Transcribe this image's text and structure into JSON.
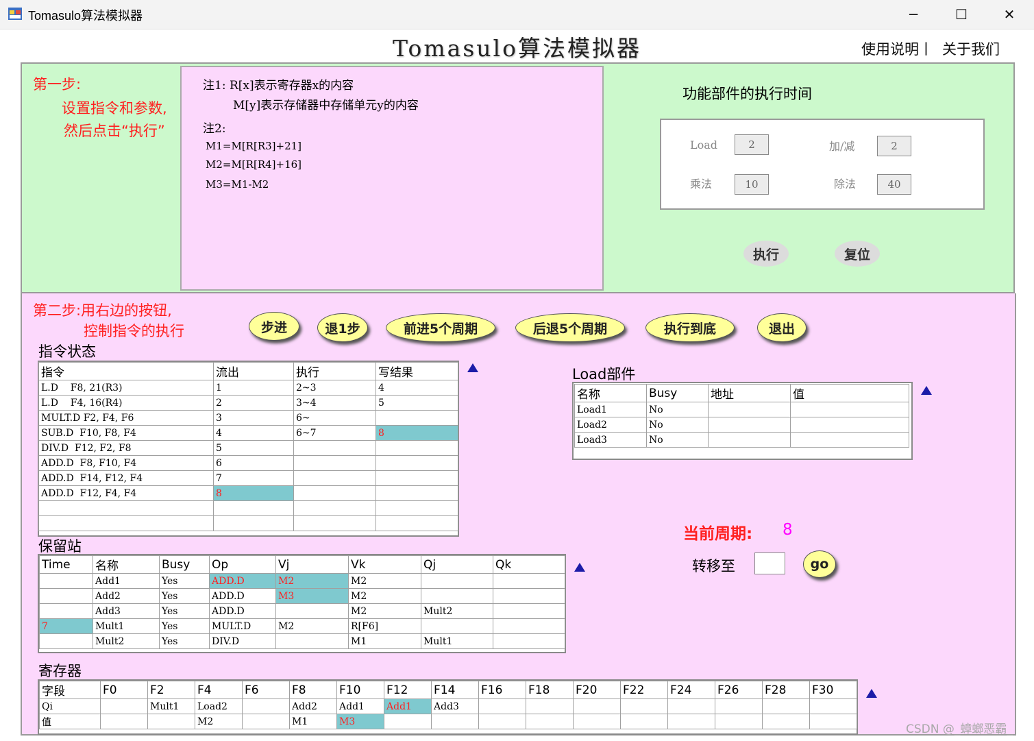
{
  "window": {
    "title": "Tomasulo算法模拟器",
    "controls": [
      "─",
      "☐",
      "✕"
    ]
  },
  "header": {
    "title": "Tomasulo算法模拟器",
    "links": [
      "使用说明丨",
      "关于我们"
    ]
  },
  "step1": {
    "label": "第一步:",
    "line1": "设置指令和参数,",
    "line2": "然后点击“执行”",
    "notes": [
      "注1: R[x]表示寄存器x的内容",
      "M[y]表示存储器中存储单元y的内容",
      "注2:",
      "M1=M[R[R3]+21]",
      "M2=M[R[R4]+16]",
      "M3=M1-M2"
    ]
  },
  "fu": {
    "title": "功能部件的执行时间",
    "load_label": "Load",
    "load_value": "2",
    "add_label": "加/减",
    "add_value": "2",
    "mul_label": "乘法",
    "mul_value": "10",
    "div_label": "除法",
    "div_value": "40",
    "execute_label": "执行",
    "reset_label": "复位"
  },
  "step2": {
    "label1": "第二步:用右边的按钮,",
    "label2": "控制指令的执行",
    "buttons": [
      "步进",
      "退1步",
      "前进5个周期",
      "后退5个周期",
      "执行到底",
      "退出"
    ]
  },
  "instr_status": {
    "title": "指令状态",
    "headers": [
      "指令",
      "流出",
      "执行",
      "写结果"
    ],
    "rows": [
      [
        "L.D    F8, 21(R3)",
        "1",
        "2~3",
        "4"
      ],
      [
        "L.D    F4, 16(R4)",
        "2",
        "3~4",
        "5"
      ],
      [
        "MULT.D F2, F4, F6",
        "3",
        "6~",
        ""
      ],
      [
        "SUB.D  F10, F8, F4",
        "4",
        "6~7",
        "8"
      ],
      [
        "DIV.D  F12, F2, F8",
        "5",
        "",
        ""
      ],
      [
        "ADD.D  F8, F10, F4",
        "6",
        "",
        ""
      ],
      [
        "ADD.D  F14, F12, F4",
        "7",
        "",
        ""
      ],
      [
        "ADD.D  F12, F4, F4",
        "8",
        "",
        ""
      ],
      [
        "",
        "",
        "",
        ""
      ],
      [
        "",
        "",
        "",
        ""
      ]
    ]
  },
  "load": {
    "title": "Load部件",
    "headers": [
      "名称",
      "Busy",
      "地址",
      "值"
    ],
    "rows": [
      [
        "Load1",
        "No",
        "",
        ""
      ],
      [
        "Load2",
        "No",
        "",
        ""
      ],
      [
        "Load3",
        "No",
        "",
        ""
      ]
    ]
  },
  "cycle": {
    "label": "当前周期:",
    "value": "8",
    "goto_label": "转移至",
    "goto_value": "",
    "go_label": "go"
  },
  "rs": {
    "title": "保留站",
    "headers": [
      "Time",
      "名称",
      "Busy",
      "Op",
      "Vj",
      "Vk",
      "Qj",
      "Qk"
    ],
    "rows": [
      [
        "",
        "Add1",
        "Yes",
        "ADD.D",
        "M2",
        "M2",
        "",
        ""
      ],
      [
        "",
        "Add2",
        "Yes",
        "ADD.D",
        "M3",
        "M2",
        "",
        ""
      ],
      [
        "",
        "Add3",
        "Yes",
        "ADD.D",
        "",
        "M2",
        "Mult2",
        ""
      ],
      [
        "7",
        "Mult1",
        "Yes",
        "MULT.D",
        "M2",
        "R[F6]",
        "",
        ""
      ],
      [
        "",
        "Mult2",
        "Yes",
        "DIV.D",
        "",
        "M1",
        "Mult1",
        ""
      ]
    ]
  },
  "regs": {
    "title": "寄存器",
    "headers": [
      "字段",
      "F0",
      "F2",
      "F4",
      "F6",
      "F8",
      "F10",
      "F12",
      "F14",
      "F16",
      "F18",
      "F20",
      "F22",
      "F24",
      "F26",
      "F28",
      "F30"
    ],
    "rows": [
      [
        "Qi",
        "",
        "Mult1",
        "Load2",
        "",
        "Add2",
        "Add1",
        "Add1",
        "Add3",
        "",
        "",
        "",
        "",
        "",
        "",
        "",
        ""
      ],
      [
        "值",
        "",
        "",
        "M2",
        "",
        "M1",
        "M3",
        "",
        "",
        "",
        "",
        "",
        "",
        "",
        "",
        "",
        ""
      ]
    ]
  },
  "watermark": "CSDN @_蟑螂恶霸_"
}
